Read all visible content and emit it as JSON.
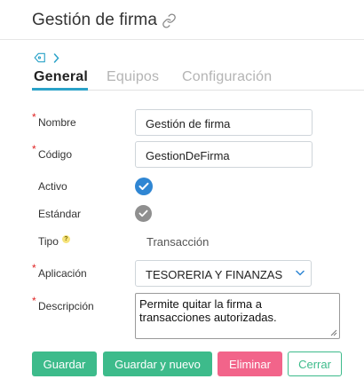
{
  "header": {
    "title": "Gestión de firma"
  },
  "tabs": [
    {
      "label": "General",
      "active": true
    },
    {
      "label": "Equipos",
      "active": false
    },
    {
      "label": "Configuración",
      "active": false
    }
  ],
  "form": {
    "nombre": {
      "label": "Nombre",
      "required_mark": "*",
      "value": "Gestión de firma"
    },
    "codigo": {
      "label": "Código",
      "required_mark": "*",
      "value": "GestionDeFirma"
    },
    "activo": {
      "label": "Activo",
      "checked": true
    },
    "estandar": {
      "label": "Estándar",
      "checked": true
    },
    "tipo": {
      "label": "Tipo",
      "help_mark": "?",
      "value": "Transacción"
    },
    "aplicacion": {
      "label": "Aplicación",
      "required_mark": "*",
      "value": "TESORERIA Y FINANZAS"
    },
    "descripcion": {
      "label": "Descripción",
      "required_mark": "*",
      "value": "Permite quitar la firma a transacciones autorizadas."
    }
  },
  "buttons": {
    "save": "Guardar",
    "save_new": "Guardar y nuevo",
    "delete": "Eliminar",
    "cancel": "Cerrar"
  },
  "colors": {
    "accent": "#2aa2c8",
    "primary_button": "#3dbb8b",
    "danger_button": "#f2648a",
    "required": "#e02424",
    "check_active": "#2f86d3",
    "check_disabled": "#8f8f8f"
  },
  "icons": {
    "title": "link-icon",
    "tag": "tag-icon",
    "chevron": "chevron-right-icon",
    "select": "chevron-down-icon",
    "check": "check-icon",
    "help": "help-icon"
  }
}
